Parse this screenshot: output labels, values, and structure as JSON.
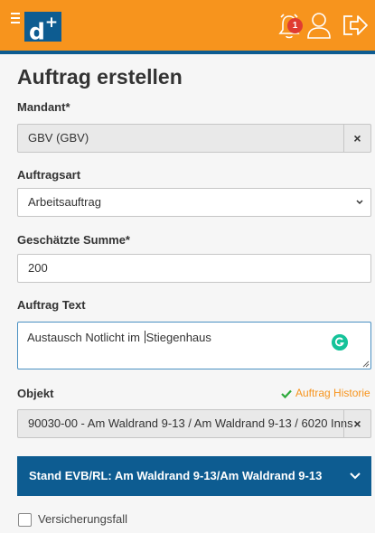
{
  "header": {
    "logo": "d",
    "logo_sup": "+",
    "notifications_count": "1",
    "icons": [
      "menu-icon",
      "bell-icon",
      "user-icon",
      "logout-icon"
    ],
    "accent_color": "#f7941d",
    "brand_color": "#0d5c91"
  },
  "page": {
    "title": "Auftrag erstellen"
  },
  "form": {
    "mandant": {
      "label": "Mandant*",
      "value": "GBV (GBV)",
      "clear": "×"
    },
    "auftragsart": {
      "label": "Auftragsart",
      "value": "Arbeitsauftrag"
    },
    "summe": {
      "label": "Geschätzte Summe*",
      "value": "200"
    },
    "text": {
      "label": "Auftrag Text",
      "value_before_caret": "Austausch Notlicht im ",
      "value_after_caret": "Stiegenhaus"
    },
    "objekt": {
      "label": "Objekt",
      "historie": "Auftrag Historie",
      "value": "90030-00 - Am Waldrand 9-13 / Am Waldrand 9-13 / 6020 Inns",
      "clear": "×"
    },
    "stand": {
      "label": "Stand EVB/RL: Am Waldrand 9-13/Am Waldrand 9-13"
    },
    "versicherungsfall": {
      "label": "Versicherungsfall",
      "checked": false
    }
  }
}
